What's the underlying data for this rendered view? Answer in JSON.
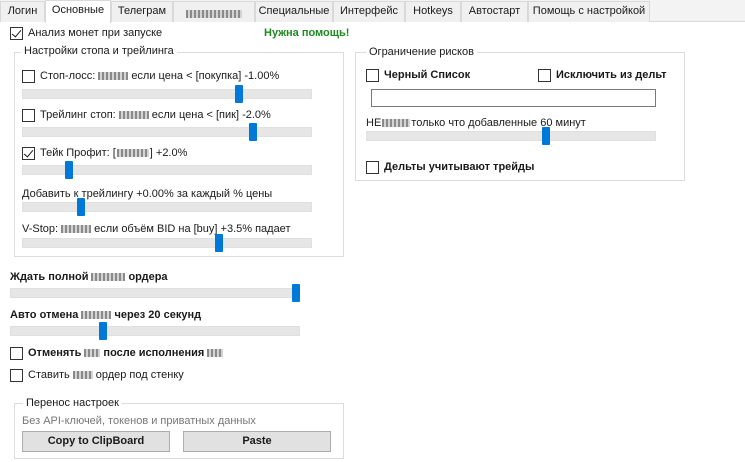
{
  "tabs": [
    {
      "label": "Логин"
    },
    {
      "label": "Основные",
      "active": true
    },
    {
      "label": "Телеграм"
    },
    {
      "label": "",
      "redacted": true
    },
    {
      "label": "Специальные"
    },
    {
      "label": "Интерфейс"
    },
    {
      "label": "Hotkeys"
    },
    {
      "label": "Автостарт"
    },
    {
      "label": "Помощь с настройкой"
    }
  ],
  "top": {
    "analyze_on_start": {
      "label": "Анализ монет при запуске",
      "checked": true
    },
    "need_help": "Нужна помощь!"
  },
  "stop_trailing": {
    "title": "Настройки стопа и трейлинга",
    "stop_loss": {
      "prefix": "Стоп-лосс:",
      "suffix": "если цена < [покупка] -1.00%",
      "checked": false,
      "level": 0.75
    },
    "trailing_stop": {
      "prefix": "Трейлинг стоп:",
      "suffix": "если цена < [пик] -2.0%",
      "checked": false,
      "level": 0.8
    },
    "take_profit": {
      "prefix": "Тейк Профит: [",
      "suffix": "] +2.0%",
      "checked": true,
      "level": 0.16
    },
    "add_trailing": {
      "label": "Добавить к трейлингу +0.00% за каждый % цены",
      "level": 0.2
    },
    "vstop": {
      "prefix": "V-Stop:",
      "suffix": "если объём BID на [buy] +3.5% падает",
      "level": 0.68
    }
  },
  "risk": {
    "title": "Ограничение рисков",
    "blacklist": {
      "label": "Черный Список",
      "checked": false
    },
    "exclude_deltas": {
      "label": "Исключить из дельт",
      "checked": false
    },
    "blacklist_value": "",
    "not_new": {
      "prefix": "НЕ",
      "suffix": "только что добавленные 60 минут",
      "level": 0.62
    },
    "deltas_trades": {
      "label": "Дельты учитывают трейды",
      "checked": false
    }
  },
  "wait_full": {
    "prefix": "Ждать полной",
    "suffix": "ордера",
    "level": 0.99
  },
  "auto_cancel": {
    "prefix": "Авто отмена",
    "suffix": "через 20 секунд",
    "level": 0.32
  },
  "cancel_after": {
    "prefix": "Отменять",
    "suffix": "после исполнения",
    "checked": false
  },
  "place_order": {
    "prefix": "Ставить",
    "suffix": "ордер под стенку",
    "checked": false
  },
  "transfer": {
    "title": "Перенос настроек",
    "note": "Без API-ключей, токенов и приватных данных",
    "copy_label": "Copy to ClipBoard",
    "paste_label": "Paste"
  },
  "colors": {
    "accent": "#0078d7",
    "help_green": "#1e8a1e"
  }
}
